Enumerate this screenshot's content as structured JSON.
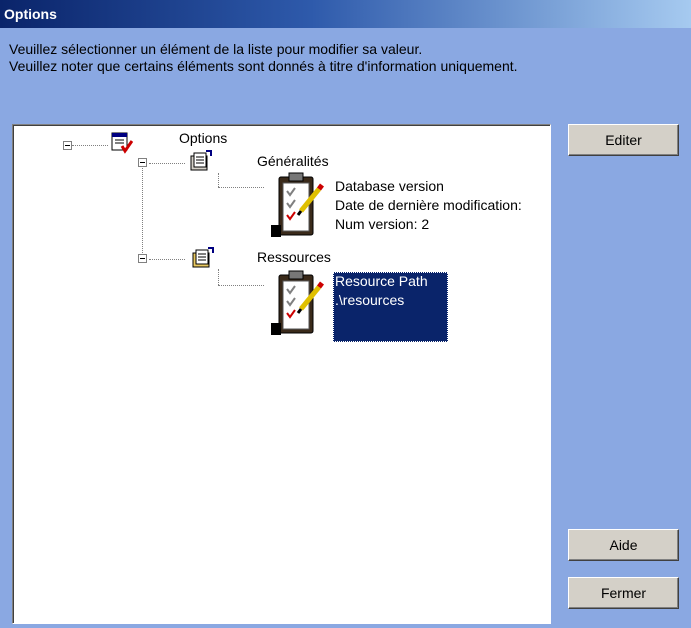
{
  "window": {
    "title": "Options"
  },
  "instructions": {
    "line1": "Veuillez sélectionner un élément de la liste pour modifier sa valeur.",
    "line2": "Veuillez noter que certains éléments sont donnés à titre d'information uniquement."
  },
  "tree": {
    "root": {
      "label": "Options",
      "icon": "options-icon"
    },
    "general": {
      "label": "Généralités",
      "icon": "properties-icon",
      "item": {
        "icon": "clipboard-icon",
        "lines": [
          "Database version",
          "Date de dernière modification:",
          "Num version: 2"
        ]
      }
    },
    "resources": {
      "label": "Ressources",
      "icon": "properties-icon",
      "item": {
        "icon": "clipboard-icon",
        "lines": [
          "Resource Path",
          ".\\resources"
        ],
        "selected": true
      }
    }
  },
  "buttons": {
    "edit": "Editer",
    "help": "Aide",
    "close": "Fermer"
  }
}
